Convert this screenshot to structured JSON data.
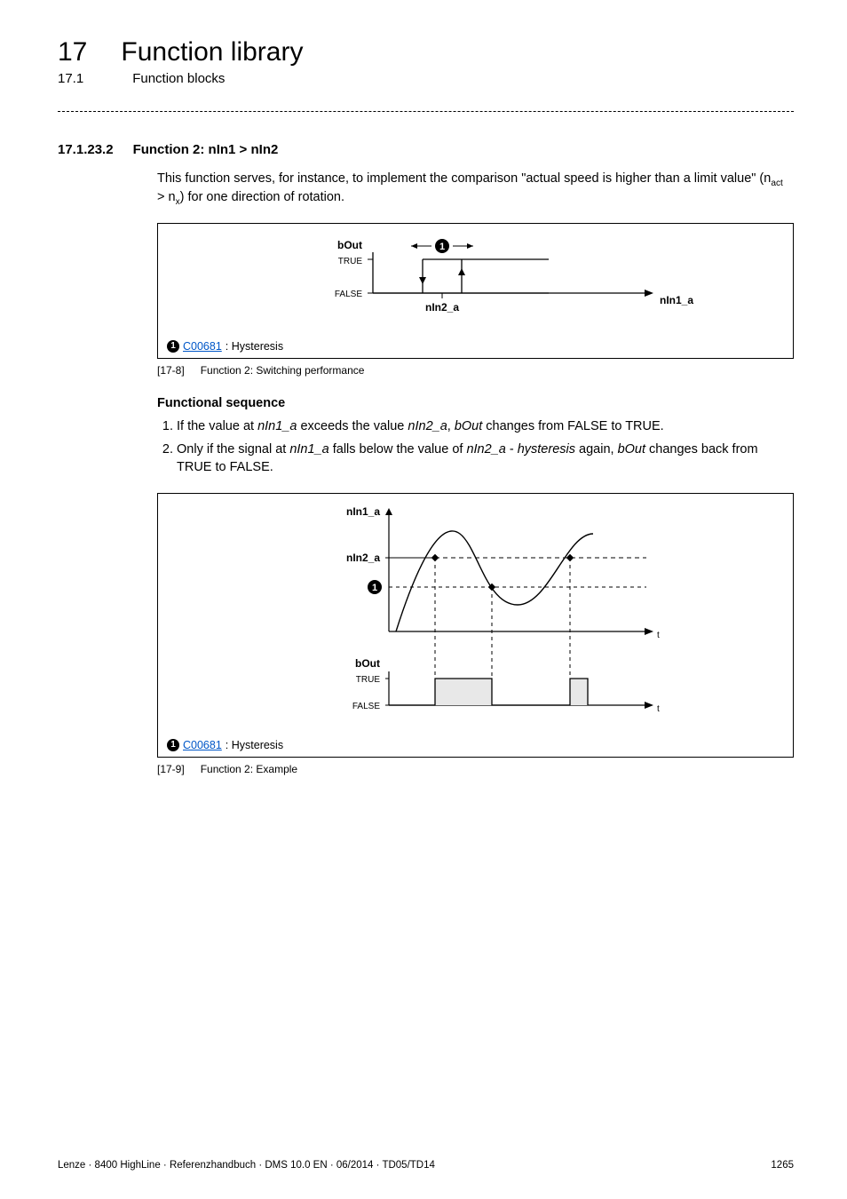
{
  "chapter": {
    "num": "17",
    "title": "Function library"
  },
  "section": {
    "num": "17.1",
    "title": "Function blocks"
  },
  "subsection": {
    "num": "17.1.23.2",
    "title": "Function 2: nIn1 > nIn2"
  },
  "intro": {
    "text_pre": "This function serves, for instance, to implement the comparison \"actual speed  is higher than a limit value\" (n",
    "sub1": "act",
    "mid": " > n",
    "sub2": "x",
    "text_post": ") for one direction of rotation."
  },
  "fig1": {
    "labels": {
      "bOut": "bOut",
      "true": "TRUE",
      "false": "FALSE",
      "nIn2_a": "nIn2_a",
      "nIn1_a": "nIn1_a"
    },
    "legend_marker": "1",
    "legend_link": "C00681",
    "legend_after": ": Hysteresis",
    "caption_tag": "[17-8]",
    "caption_text": "Function 2: Switching performance"
  },
  "functional": {
    "heading": "Functional sequence",
    "item1": {
      "pre": "If the value at ",
      "v1": "nIn1_a",
      "mid1": " exceeds the value ",
      "v2": "nIn2_a",
      "mid2": ", ",
      "v3": "bOut",
      "post": " changes from FALSE to TRUE."
    },
    "item2": {
      "pre": "Only if the signal at ",
      "v1": "nIn1_a",
      "mid1": " falls below the value of ",
      "v2": "nIn2_a",
      "mid2": " - ",
      "v3": "hysteresis",
      "mid3": " again, ",
      "v4": "bOut",
      "post": " changes back from TRUE to FALSE."
    }
  },
  "fig2": {
    "labels": {
      "nIn1_a": "nIn1_a",
      "nIn2_a": "nIn2_a",
      "bOut": "bOut",
      "true": "TRUE",
      "false": "FALSE",
      "t": "t"
    },
    "legend_marker": "1",
    "legend_link": "C00681",
    "legend_after": ": Hysteresis",
    "caption_tag": "[17-9]",
    "caption_text": "Function 2: Example"
  },
  "footer": {
    "left": "Lenze · 8400 HighLine · Referenzhandbuch · DMS 10.0 EN · 06/2014 · TD05/TD14",
    "right": "1265"
  },
  "chart_data": [
    {
      "type": "line",
      "title": "Function 2: Switching performance",
      "xlabel": "nIn1_a",
      "ylabel": "bOut",
      "y_categories": [
        "FALSE",
        "TRUE"
      ],
      "hysteresis_band_label": "1 (C00681)",
      "series": [
        {
          "name": "bOut vs nIn1_a (rising)",
          "description": "bOut switches FALSE→TRUE when nIn1_a rises above nIn2_a",
          "threshold_x": "nIn2_a"
        },
        {
          "name": "bOut vs nIn1_a (falling)",
          "description": "bOut switches TRUE→FALSE when nIn1_a falls below nIn2_a − hysteresis",
          "threshold_x": "nIn2_a − hysteresis"
        }
      ]
    },
    {
      "type": "line",
      "title": "Function 2: Example",
      "xlabel": "t",
      "panels": [
        {
          "ylabel": "nIn1_a",
          "reference_lines": [
            {
              "name": "nIn2_a",
              "style": "solid-then-dashed"
            },
            {
              "name": "nIn2_a − hysteresis (1)",
              "style": "dashed"
            }
          ],
          "series": [
            {
              "name": "nIn1_a(t)",
              "description": "Signal rises above nIn2_a (crossing c1), falls below nIn2_a−hysteresis (crossing c2), rises again above nIn2_a (crossing c3)"
            }
          ],
          "crossings": [
            "c1",
            "c2",
            "c3"
          ]
        },
        {
          "ylabel": "bOut",
          "y_categories": [
            "FALSE",
            "TRUE"
          ],
          "series": [
            {
              "name": "bOut(t)",
              "segments": [
                {
                  "from": "start",
                  "to": "c1",
                  "value": "FALSE"
                },
                {
                  "from": "c1",
                  "to": "c2",
                  "value": "TRUE"
                },
                {
                  "from": "c2",
                  "to": "c3",
                  "value": "FALSE"
                },
                {
                  "from": "c3",
                  "to": "end",
                  "value": "TRUE"
                }
              ]
            }
          ]
        }
      ]
    }
  ]
}
